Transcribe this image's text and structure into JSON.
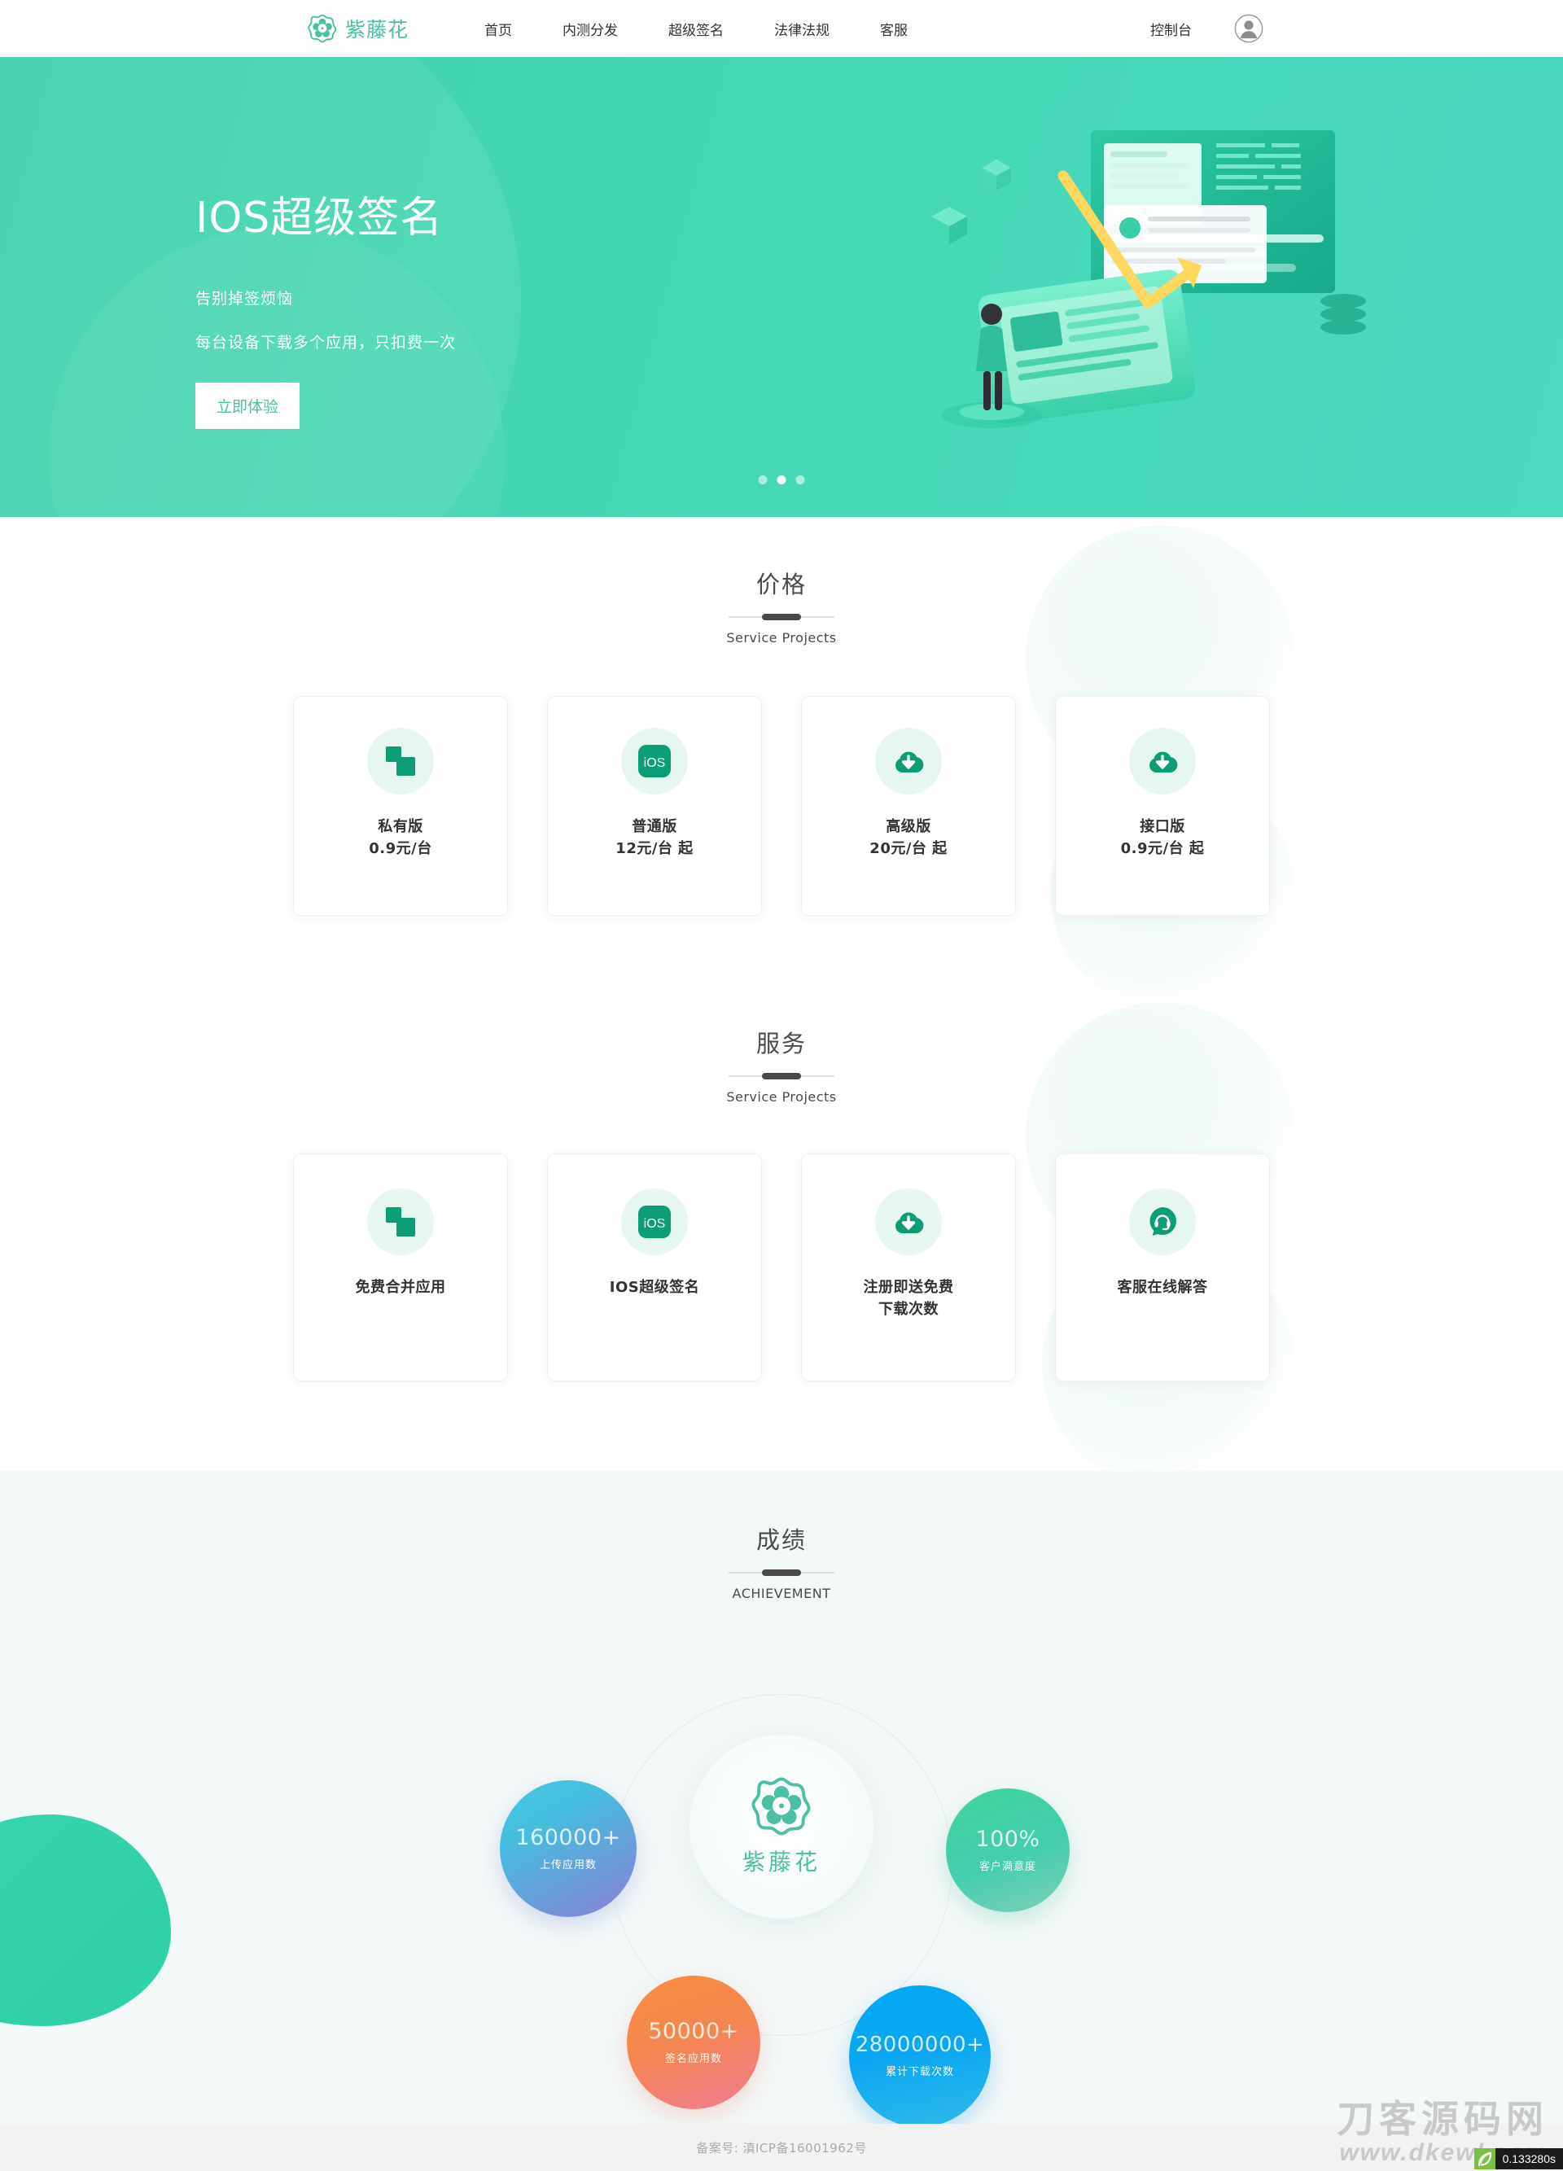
{
  "header": {
    "brand": {
      "name": "紫藤花",
      "icon": "flower-hexagon-logo"
    },
    "nav": [
      {
        "label": "首页",
        "name": "nav-home"
      },
      {
        "label": "内测分发",
        "name": "nav-beta-distribution"
      },
      {
        "label": "超级签名",
        "name": "nav-super-signature"
      },
      {
        "label": "法律法规",
        "name": "nav-legal"
      },
      {
        "label": "客服",
        "name": "nav-support"
      }
    ],
    "console_label": "控制台",
    "avatar_icon": "user-avatar-icon"
  },
  "hero": {
    "title": "IOS超级签名",
    "subtitle_1": "告别掉签烦恼",
    "subtitle_2": "每台设备下载多个应用，只扣费一次",
    "cta_label": "立即体验",
    "slide_count": 3,
    "active_slide": 2,
    "bg_color": "#45d4b2"
  },
  "price_section": {
    "title": "价格",
    "subtitle": "Service Projects",
    "cards": [
      {
        "icon": "merge-apps-icon",
        "name": "私有版",
        "price": "0.9元/台"
      },
      {
        "icon": "ios-icon",
        "name": "普通版",
        "price": "12元/台 起"
      },
      {
        "icon": "cloud-download-icon",
        "name": "高级版",
        "price": "20元/台 起"
      },
      {
        "icon": "cloud-download-icon",
        "name": "接口版",
        "price": "0.9元/台 起"
      }
    ]
  },
  "service_section": {
    "title": "服务",
    "subtitle": "Service Projects",
    "cards": [
      {
        "icon": "merge-apps-icon",
        "line1": "免费合并应用",
        "line2": ""
      },
      {
        "icon": "ios-icon",
        "line1": "IOS超级签名",
        "line2": ""
      },
      {
        "icon": "cloud-download-icon",
        "line1": "注册即送免费",
        "line2": "下载次数"
      },
      {
        "icon": "headset-support-icon",
        "line1": "客服在线解答",
        "line2": ""
      }
    ]
  },
  "achievement_section": {
    "title": "成绩",
    "subtitle": "ACHIEVEMENT",
    "center": {
      "name": "紫藤花",
      "icon": "flower-hexagon-logo"
    },
    "stats": [
      {
        "key": "upload",
        "value": "160000+",
        "label": "上传应用数",
        "color_from": "#49c6e0",
        "color_to": "#8b7fd4"
      },
      {
        "key": "satisfaction",
        "value": "100%",
        "label": "客户满意度",
        "color_from": "#3fd39b",
        "color_to": "#7fd0b8"
      },
      {
        "key": "signed",
        "value": "50000+",
        "label": "签名应用数",
        "color_from": "#f98e3f",
        "color_to": "#ee7d94"
      },
      {
        "key": "downloads",
        "value": "28000000+",
        "label": "累计下载次数",
        "color_from": "#05a8f5",
        "color_to": "#2fb9e8"
      }
    ]
  },
  "footer": {
    "icp_text": "备案号: 滇ICP备16001962号"
  },
  "watermark": {
    "cn": "刀客源码网",
    "en": "www.dkewl.com"
  },
  "perf_badge": {
    "time": "0.133280s",
    "icon": "leaf-icon"
  }
}
